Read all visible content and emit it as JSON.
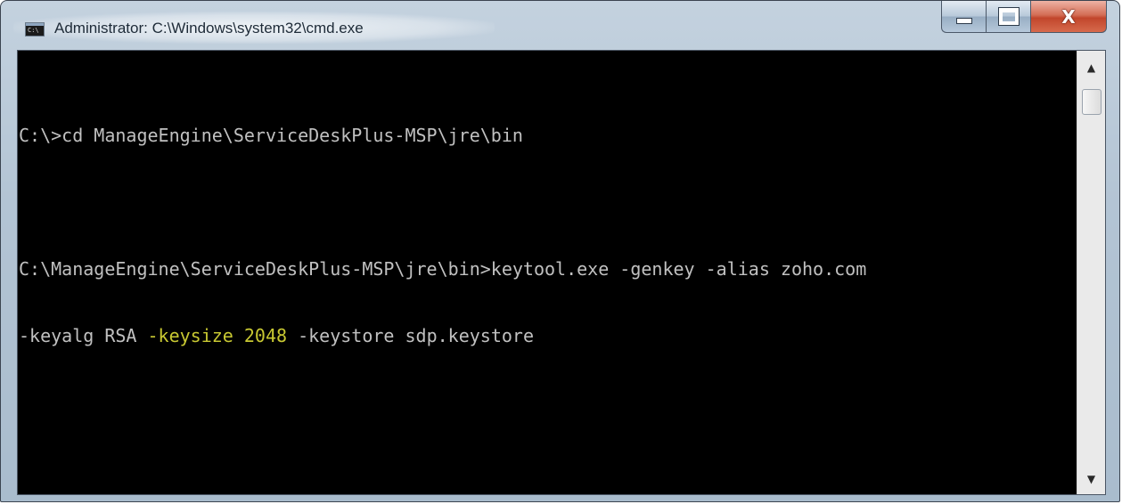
{
  "window": {
    "title": "Administrator: C:\\Windows\\system32\\cmd.exe",
    "icon": "cmd-icon",
    "icon_text": "C:\\"
  },
  "caption_buttons": {
    "minimize": "minimize-icon",
    "maximize": "maximize-icon",
    "close": "close-icon",
    "close_glyph": "X"
  },
  "console": {
    "lines": [
      "C:\\>cd ManageEngine\\ServiceDeskPlus-MSP\\jre\\bin",
      "C:\\ManageEngine\\ServiceDeskPlus-MSP\\jre\\bin>keytool.exe -genkey -alias zoho.com"
    ],
    "line3": {
      "pre": "-keyalg RSA ",
      "highlight": "-keysize 2048",
      "post": " -keystore sdp.keystore"
    },
    "text_color": "#c0c0c0",
    "highlight_color": "#c8c832",
    "background": "#000000"
  },
  "scrollbar": {
    "up_arrow": "▲",
    "down_arrow": "▼"
  }
}
